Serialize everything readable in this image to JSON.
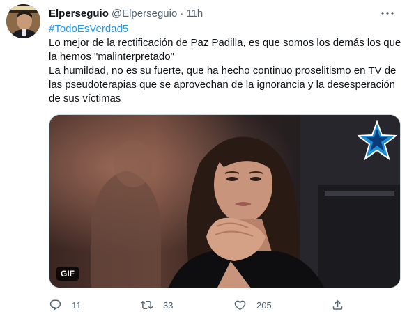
{
  "tweet": {
    "author_name": "Elperseguio",
    "author_handle": "@Elperseguio",
    "separator": "·",
    "time": "11h",
    "hashtag": "#TodoEsVerdad5",
    "lines": [
      "Lo mejor de la rectificación de Paz Padilla, es que somos los demás los que",
      "la hemos \"malinterpretado\"",
      "La humildad, no es su fuerte, que ha hecho continuo proselitismo en TV de",
      "las pseudoterapias que se aprovechan de la ignorancia y la desesperación",
      "de sus víctimas"
    ],
    "media_badge": "GIF"
  },
  "actions": {
    "replies": "11",
    "retweets": "33",
    "likes": "205"
  },
  "icons": {
    "more": "more-icon",
    "reply": "reply-icon",
    "retweet": "retweet-icon",
    "like": "heart-icon",
    "share": "share-icon"
  },
  "colors": {
    "accent": "#1d9bf0",
    "secondary_text": "#536471",
    "primary_text": "#0f1419"
  }
}
